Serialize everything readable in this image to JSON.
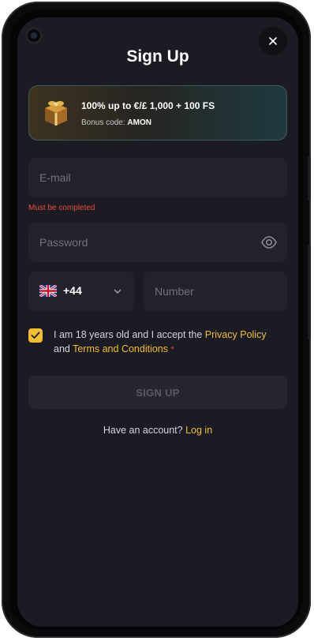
{
  "modal": {
    "title": "Sign Up",
    "close_icon": "close-icon"
  },
  "bonus": {
    "title": "100% up to €/£ 1,000 + 100 FS",
    "code_label": "Bonus code:",
    "code_value": "AMON",
    "icon": "gift-box-icon"
  },
  "form": {
    "email_placeholder": "E-mail",
    "email_value": "",
    "email_error": "Must be completed",
    "password_placeholder": "Password",
    "password_value": "",
    "password_toggle_icon": "eye-icon",
    "country_code": "+44",
    "country_flag_icon": "uk-flag-icon",
    "number_placeholder": "Number",
    "number_value": ""
  },
  "consent": {
    "checked": true,
    "text_1": "I am 18 years old and I accept the ",
    "privacy_link": "Privacy Policy",
    "text_2": " and ",
    "terms_link": "Terms and Conditions",
    "required_mark": "*"
  },
  "actions": {
    "signup_label": "SIGN UP",
    "have_account": "Have an account? ",
    "login_link": "Log in"
  },
  "colors": {
    "accent": "#f3be2d",
    "error": "#e94b3c",
    "background": "#1b1b24",
    "field": "#22222d"
  }
}
